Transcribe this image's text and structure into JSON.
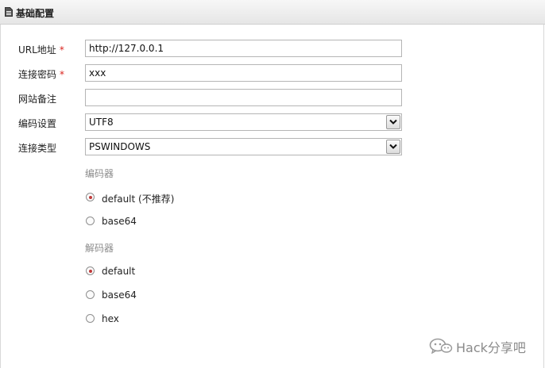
{
  "panel": {
    "title": "基础配置",
    "icon": "document-icon"
  },
  "form": {
    "url": {
      "label": "URL地址",
      "required_mark": "*",
      "value": "http://127.0.0.1"
    },
    "password": {
      "label": "连接密码",
      "required_mark": "*",
      "value": "xxx"
    },
    "note": {
      "label": "网站备注",
      "value": ""
    },
    "encoding": {
      "label": "编码设置",
      "value": "UTF8"
    },
    "conn_type": {
      "label": "连接类型",
      "value": "PSWINDOWS"
    }
  },
  "encoder": {
    "title": "编码器",
    "options": [
      {
        "label": "default (不推荐)",
        "checked": true
      },
      {
        "label": "base64",
        "checked": false
      }
    ]
  },
  "decoder": {
    "title": "解码器",
    "options": [
      {
        "label": "default",
        "checked": true
      },
      {
        "label": "base64",
        "checked": false
      },
      {
        "label": "hex",
        "checked": false
      }
    ]
  },
  "watermark": {
    "text": "Hack分享吧",
    "icon": "wechat-icon"
  },
  "colors": {
    "required": "#d9231d",
    "section_title": "#8c8c8c",
    "radio_dot": "#c03a3a"
  }
}
